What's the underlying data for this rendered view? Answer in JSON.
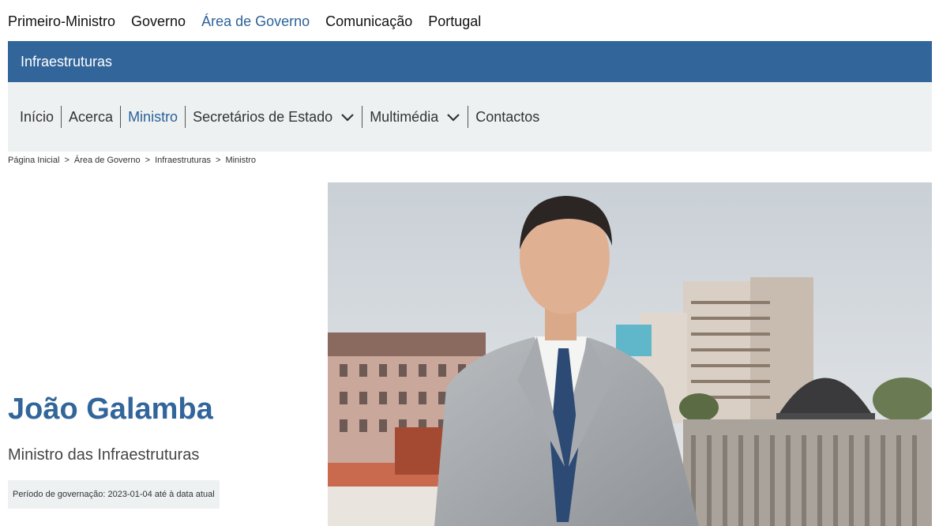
{
  "topnav": {
    "items": [
      "Primeiro-Ministro",
      "Governo",
      "Área de Governo",
      "Comunicação",
      "Portugal"
    ],
    "active": "Área de Governo"
  },
  "area": {
    "title": "Infraestruturas"
  },
  "subnav": {
    "items": [
      {
        "label": "Início",
        "dropdown": false
      },
      {
        "label": "Acerca",
        "dropdown": false
      },
      {
        "label": "Ministro",
        "dropdown": false,
        "active": true
      },
      {
        "label": "Secretários de Estado",
        "dropdown": true
      },
      {
        "label": "Multimédia",
        "dropdown": true
      },
      {
        "label": "Contactos",
        "dropdown": false
      }
    ]
  },
  "breadcrumb": {
    "items": [
      "Página Inicial",
      "Área de Governo",
      "Infraestruturas",
      "Ministro"
    ],
    "separator": ">"
  },
  "profile": {
    "name": "João Galamba",
    "role": "Ministro das Infraestruturas",
    "period": "Período de governação: 2023-01-04 até à data atual"
  },
  "colors": {
    "brand_blue": "#32659a",
    "active_link": "#2c6298",
    "subnav_bg": "#eef1f2"
  }
}
